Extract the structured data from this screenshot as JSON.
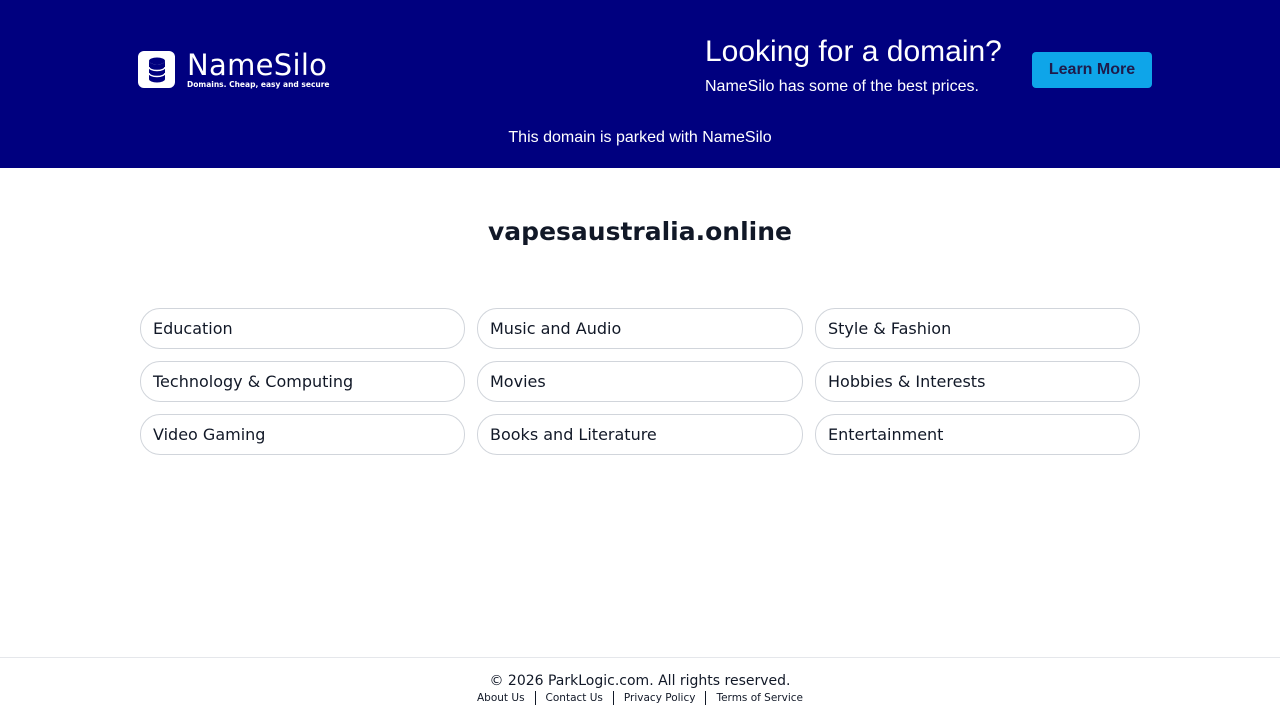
{
  "header": {
    "brand_name": "NameSilo",
    "brand_tagline": "Domains. Cheap, easy and secure",
    "promo_title": "Looking for a domain?",
    "promo_subtitle": "NameSilo has some of the best prices.",
    "cta_label": "Learn More",
    "parked_notice": "This domain is parked with NameSilo"
  },
  "colors": {
    "banner_bg": "#00007f",
    "cta_bg": "#0ea5e9"
  },
  "main": {
    "domain": "vapesaustralia.online",
    "categories": [
      "Education",
      "Music and Audio",
      "Style & Fashion",
      "Technology & Computing",
      "Movies",
      "Hobbies & Interests",
      "Video Gaming",
      "Books and Literature",
      "Entertainment"
    ]
  },
  "footer": {
    "copyright": "© 2026 ParkLogic.com. All rights reserved.",
    "links": [
      "About Us",
      "Contact Us",
      "Privacy Policy",
      "Terms of Service"
    ]
  }
}
